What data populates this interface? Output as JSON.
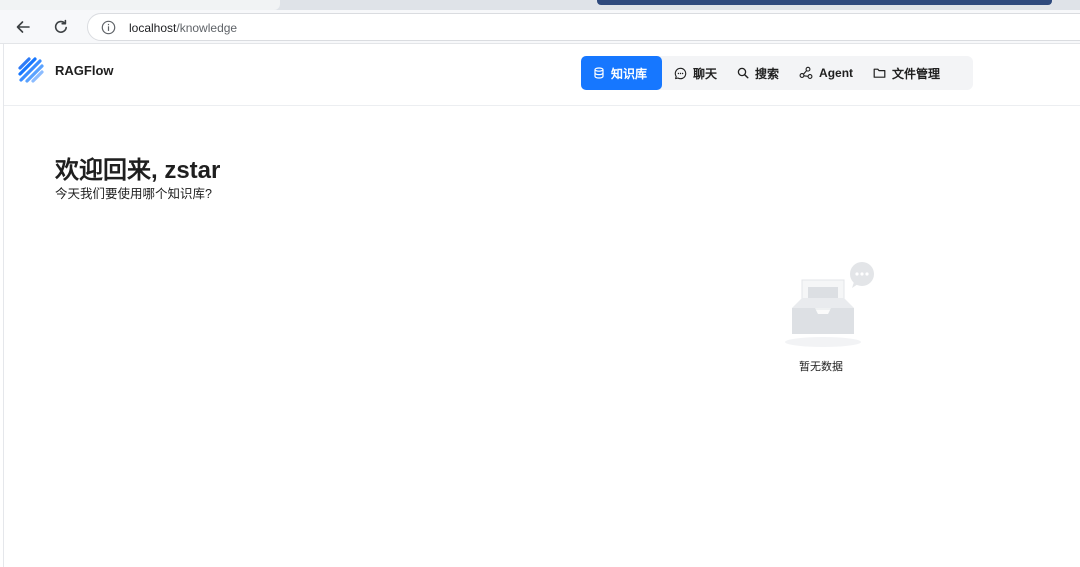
{
  "browser": {
    "url_host": "localhost",
    "url_path": "/knowledge"
  },
  "app": {
    "name": "RAGFlow"
  },
  "nav": {
    "items": [
      {
        "label": "知识库",
        "icon": "database-icon",
        "active": true
      },
      {
        "label": "聊天",
        "icon": "chat-icon",
        "active": false
      },
      {
        "label": "搜索",
        "icon": "search-icon",
        "active": false
      },
      {
        "label": "Agent",
        "icon": "graph-icon",
        "active": false
      },
      {
        "label": "文件管理",
        "icon": "folder-icon",
        "active": false
      }
    ]
  },
  "main": {
    "welcome": "欢迎回来, zstar",
    "subtitle": "今天我们要使用哪个知识库?",
    "empty_text": "暂无数据"
  },
  "colors": {
    "accent": "#1677ff",
    "nav_background": "#f3f4f6"
  }
}
